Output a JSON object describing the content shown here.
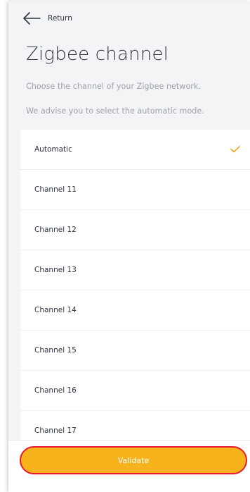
{
  "header": {
    "back_label": "Return"
  },
  "page": {
    "title": "Zigbee channel",
    "subtitle_1": "Choose the channel of your Zigbee network.",
    "subtitle_2": "We advise you to select the automatic mode."
  },
  "channels": {
    "items": [
      {
        "label": "Automatic",
        "selected": true
      },
      {
        "label": "Channel 11",
        "selected": false
      },
      {
        "label": "Channel 12",
        "selected": false
      },
      {
        "label": "Channel 13",
        "selected": false
      },
      {
        "label": "Channel 14",
        "selected": false
      },
      {
        "label": "Channel 15",
        "selected": false
      },
      {
        "label": "Channel 16",
        "selected": false
      },
      {
        "label": "Channel 17",
        "selected": false
      }
    ]
  },
  "footer": {
    "validate_label": "Validate"
  },
  "colors": {
    "accent": "#f7b21c",
    "check": "#f5a623",
    "focus_ring": "#e8192c"
  },
  "icons": {
    "back": "arrow-left-icon",
    "selected": "checkmark-icon"
  }
}
